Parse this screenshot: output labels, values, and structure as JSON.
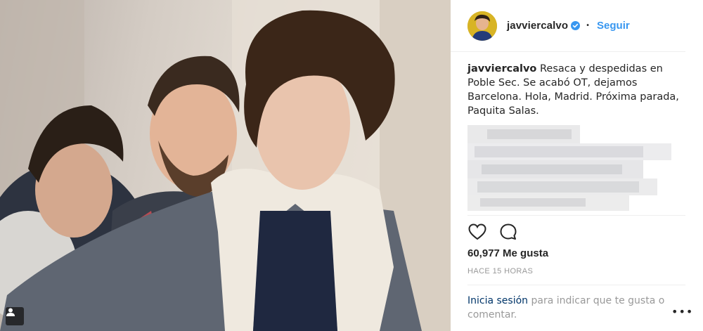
{
  "post": {
    "username": "javviercalvo",
    "verified": true,
    "separator": "•",
    "follow_label": "Seguir",
    "caption_user": "javviercalvo",
    "caption_text": "Resaca y despedidas en Poble Sec. Se acabó OT, dejamos Barcelona. Hola, Madrid. Próxima parada, Paquita Salas.",
    "likes": "60,977 Me gusta",
    "time": "HACE 15 HORAS",
    "login_link": "Inicia sesión",
    "login_rest": " para indicar que te gusta o comentar.",
    "more_label": "•••"
  },
  "icons": {
    "heart": "heart-icon",
    "comment": "comment-icon",
    "verified": "verified-badge-icon",
    "user": "user-tag-icon",
    "more": "more-options-icon"
  },
  "colors": {
    "link": "#3897f0",
    "dark_link": "#003569",
    "muted": "#999999",
    "verified": "#3897f0"
  }
}
